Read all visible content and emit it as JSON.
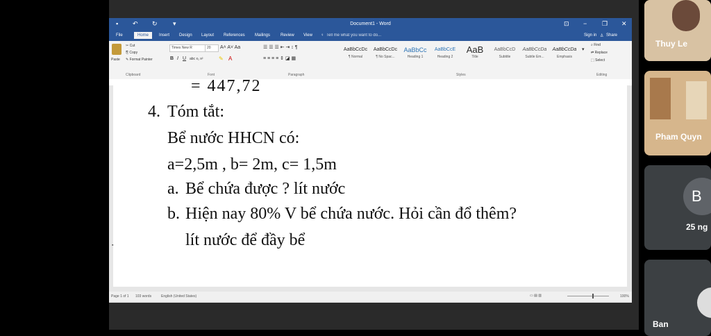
{
  "word": {
    "title": "Document1 - Word",
    "tabs": [
      "File",
      "Home",
      "Insert",
      "Design",
      "Layout",
      "References",
      "Mailings",
      "Review",
      "View"
    ],
    "tell_me": "Tell me what you want to do...",
    "sign_in": "Sign in",
    "share": "Share",
    "clipboard": {
      "paste": "Paste",
      "cut": "Cut",
      "copy": "Copy",
      "format_painter": "Format Painter",
      "label": "Clipboard"
    },
    "font": {
      "name": "Times New R",
      "size": "20",
      "label": "Font"
    },
    "paragraph_label": "Paragraph",
    "styles_label": "Styles",
    "editing": {
      "find": "Find",
      "replace": "Replace",
      "select": "Select",
      "label": "Editing"
    },
    "styles": [
      {
        "sample": "AaBbCcDc",
        "name": "¶ Normal"
      },
      {
        "sample": "AaBbCcDc",
        "name": "¶ No Spac..."
      },
      {
        "sample": "AaBbCc",
        "name": "Heading 1"
      },
      {
        "sample": "AaBbCcE",
        "name": "Heading 2"
      },
      {
        "sample": "AaB",
        "name": "Title"
      },
      {
        "sample": "AaBbCcD",
        "name": "Subtitle"
      },
      {
        "sample": "AaBbCcDa",
        "name": "Subtle Em..."
      },
      {
        "sample": "AaBbCcDa",
        "name": "Emphasis"
      }
    ],
    "status": {
      "page": "Page 1 of 1",
      "words": "103 words",
      "lang": "English (United States)",
      "zoom": "100%"
    }
  },
  "document": {
    "partial_line": "= 447,72",
    "heading_num": "4.",
    "heading": "Tóm tắt:",
    "line1": "Bể nước HHCN có:",
    "line2": "a=2,5m , b= 2m,  c= 1,5m",
    "a_label": "a.",
    "a_text": "Bể chứa được ? lít nước",
    "b_label": "b.",
    "b_text": "Hiện nay 80% V bể chứa nước. Hỏi cần đổ thêm?",
    "b_text2": "lít nước để đầy bể"
  },
  "participants": [
    {
      "name": "Thuy Le"
    },
    {
      "name": "Pham Quyn"
    },
    {
      "initial": "B",
      "name": "25 ng"
    },
    {
      "name": "Ban"
    }
  ],
  "colors": {
    "word_blue": "#2b579a",
    "tile_bg": "#3c4043"
  }
}
